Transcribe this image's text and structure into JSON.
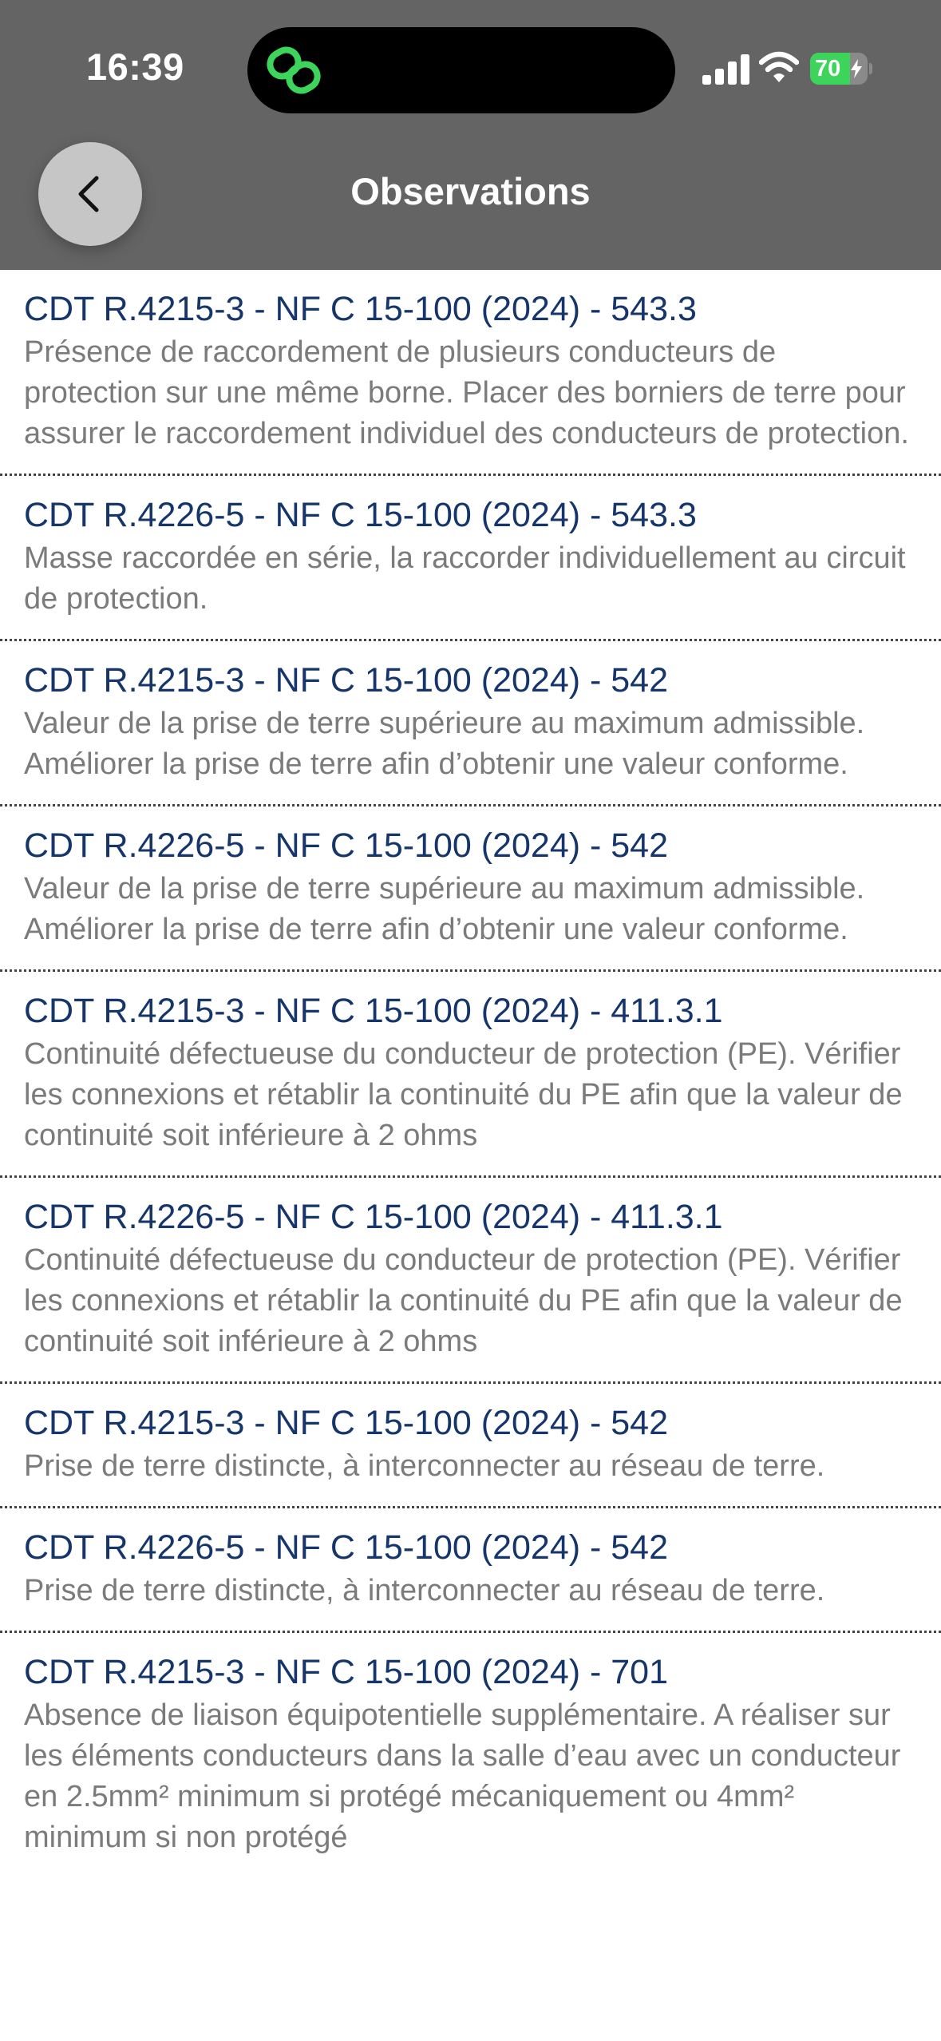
{
  "status_bar": {
    "time": "16:39",
    "battery": "70",
    "battery_level": 0.7
  },
  "header": {
    "title": "Observations"
  },
  "icons": {
    "back": "chevron-left-icon",
    "island_app": "link-icon",
    "signal": "cellular-signal-icon",
    "wifi": "wifi-icon",
    "charging": "bolt-icon"
  },
  "colors": {
    "header_bg": "#646464",
    "title_blue": "#16366b",
    "desc_gray": "#7b7b7b",
    "island_green": "#3dd45b"
  },
  "observations": [
    {
      "title": "CDT R.4215-3 - NF C 15-100 (2024) - 543.3",
      "description": "Présence de raccordement de plusieurs conducteurs de protection sur une même borne. Placer des borniers de terre pour assurer le raccordement individuel des conducteurs de protection."
    },
    {
      "title": "CDT R.4226-5 - NF C 15-100 (2024) - 543.3",
      "description": "Masse raccordée en série, la raccorder individuellement au circuit de protection."
    },
    {
      "title": "CDT R.4215-3 - NF C 15-100 (2024) - 542",
      "description": "Valeur de la prise de terre supérieure au maximum admissible. Améliorer la prise de terre afin d’obtenir une valeur conforme."
    },
    {
      "title": "CDT R.4226-5 - NF C 15-100 (2024) - 542",
      "description": "Valeur de la prise de terre supérieure au maximum admissible. Améliorer la prise de terre afin d’obtenir une valeur conforme."
    },
    {
      "title": "CDT R.4215-3 - NF C 15-100 (2024) - 411.3.1",
      "description": "Continuité défectueuse du conducteur de protection (PE). Vérifier les connexions et rétablir la continuité du PE afin que la valeur de continuité soit inférieure à 2 ohms"
    },
    {
      "title": "CDT R.4226-5 - NF C 15-100 (2024) - 411.3.1",
      "description": "Continuité défectueuse du conducteur de protection (PE). Vérifier les connexions et rétablir la continuité du PE afin que la valeur de continuité soit inférieure à 2 ohms"
    },
    {
      "title": "CDT R.4215-3 - NF C 15-100 (2024) - 542",
      "description": "Prise de terre distincte, à interconnecter au réseau de terre."
    },
    {
      "title": "CDT R.4226-5 - NF C 15-100 (2024) - 542",
      "description": "Prise de terre distincte, à interconnecter au réseau de terre."
    },
    {
      "title": "CDT R.4215-3 - NF C 15-100 (2024) - 701",
      "description": "Absence de liaison équipotentielle supplémentaire. A réaliser sur les éléments conducteurs dans la salle d’eau avec un conducteur en 2.5mm² minimum si protégé mécaniquement ou 4mm² minimum si non protégé"
    }
  ]
}
